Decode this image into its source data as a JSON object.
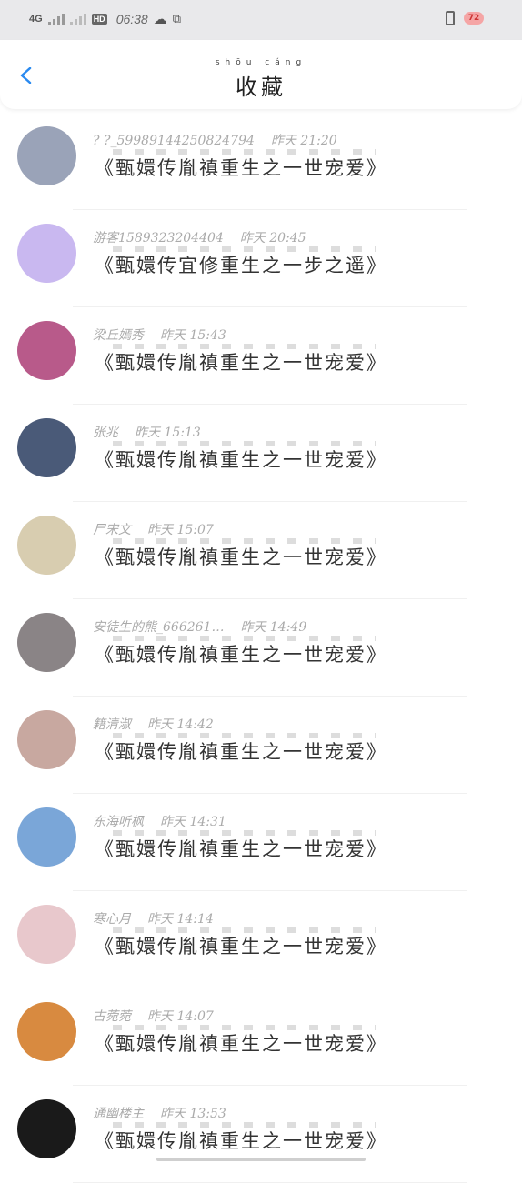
{
  "status_bar": {
    "network": "4G",
    "hd": "HD",
    "time": "06:38",
    "battery": "72"
  },
  "header": {
    "title": "收藏",
    "title_pinyin": "shōu cáng"
  },
  "items": [
    {
      "name": "? ?_599891442508​24794",
      "time": "昨天 21:20",
      "novel": "《甄嬛传胤禛重生之一世宠爱》",
      "avatar_color": "#9aa3b8"
    },
    {
      "name": "游客15893232044​04",
      "time": "昨天 20:45",
      "novel": "《甄嬛传宜修重生之一步之遥》",
      "avatar_color": "#c9b8f0"
    },
    {
      "name": "梁丘嫣秀",
      "time": "昨天 15:43",
      "novel": "《甄嬛传胤禛重生之一世宠爱》",
      "avatar_color": "#b85a8a"
    },
    {
      "name": "张兆",
      "time": "昨天 15:13",
      "novel": "《甄嬛传胤禛重生之一世宠爱》",
      "avatar_color": "#4a5a78"
    },
    {
      "name": "尸宋文",
      "time": "昨天 15:07",
      "novel": "《甄嬛传胤禛重生之一世宠爱》",
      "avatar_color": "#d8cdb0"
    },
    {
      "name": "安徒生的熊_666261…",
      "time": "昨天 14:49",
      "novel": "《甄嬛传胤禛重生之一世宠爱》",
      "avatar_color": "#8a8486"
    },
    {
      "name": "籍清淑",
      "time": "昨天 14:42",
      "novel": "《甄嬛传胤禛重生之一世宠爱》",
      "avatar_color": "#c8a8a0"
    },
    {
      "name": "东海听枫",
      "time": "昨天 14:31",
      "novel": "《甄嬛传胤禛重生之一世宠爱》",
      "avatar_color": "#7aa6d8"
    },
    {
      "name": "寒心月",
      "time": "昨天 14:14",
      "novel": "《甄嬛传胤禛重生之一世宠爱》",
      "avatar_color": "#e8c8cc"
    },
    {
      "name": "古菀菀",
      "time": "昨天 14:07",
      "novel": "《甄嬛传胤禛重生之一世宠爱》",
      "avatar_color": "#d88a40"
    },
    {
      "name": "通幽楼主",
      "time": "昨天 13:53",
      "novel": "《甄嬛传胤禛重生之一世宠爱》",
      "avatar_color": "#1a1a1a"
    }
  ]
}
